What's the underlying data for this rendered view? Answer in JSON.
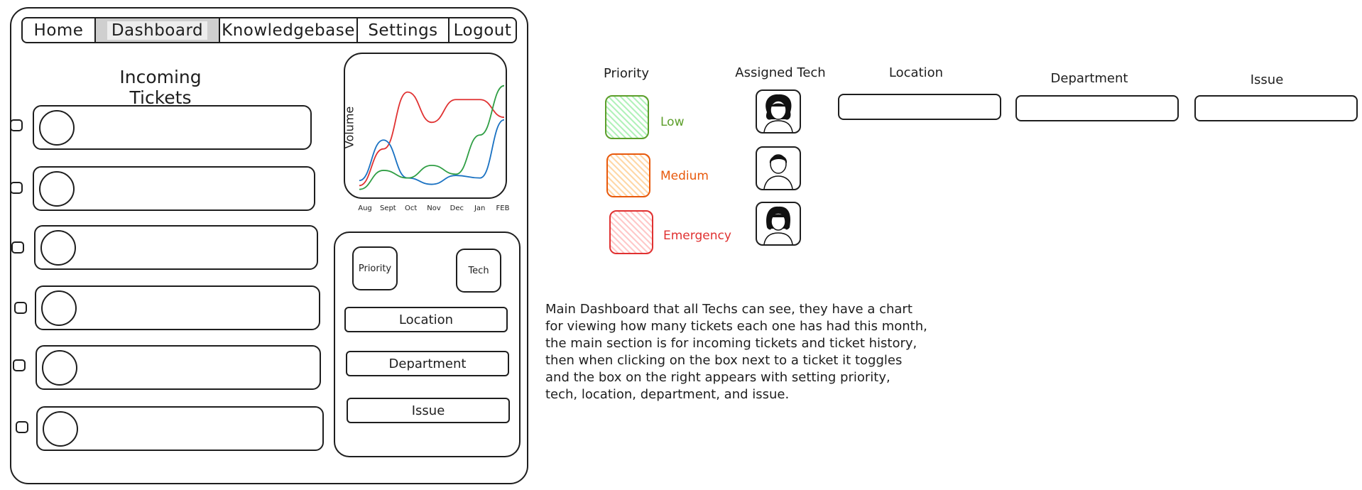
{
  "nav": {
    "tabs": [
      {
        "label": "Home"
      },
      {
        "label": "Dashboard",
        "active": true
      },
      {
        "label": "Knowledgebase"
      },
      {
        "label": "Settings"
      },
      {
        "label": "Logout"
      }
    ]
  },
  "tickets": {
    "title": "Incoming Tickets",
    "count": 6
  },
  "chart_data": {
    "type": "line",
    "ylabel": "Volume",
    "xlabel": "",
    "categories": [
      "Aug",
      "Sept",
      "Oct",
      "Nov",
      "Dec",
      "Jan",
      "FEB"
    ],
    "ylim": [
      0,
      10
    ],
    "series": [
      {
        "color": "#e03131",
        "values": [
          0.6,
          3.5,
          8.0,
          5.6,
          7.4,
          7.4,
          6.0
        ]
      },
      {
        "color": "#1971c2",
        "values": [
          1.0,
          4.2,
          1.2,
          0.7,
          1.4,
          1.2,
          5.8
        ]
      },
      {
        "color": "#2f9e44",
        "values": [
          0.3,
          1.8,
          1.2,
          2.2,
          1.5,
          4.6,
          8.5
        ]
      }
    ]
  },
  "detail_panel": {
    "priority_label": "Priority",
    "tech_label": "Tech",
    "location_label": "Location",
    "department_label": "Department",
    "issue_label": "Issue"
  },
  "legend": {
    "priority_header": "Priority",
    "assigned_tech_header": "Assigned Tech",
    "location_header": "Location",
    "department_header": "Department",
    "issue_header": "Issue",
    "priorities": [
      {
        "label": "Low",
        "color": "#5c9e2a",
        "fill": "#b2f2bb"
      },
      {
        "label": "Medium",
        "color": "#e8590c",
        "fill": "#ffd8a8"
      },
      {
        "label": "Emergency",
        "color": "#e03131",
        "fill": "#ffc9c9"
      }
    ]
  },
  "description": "Main Dashboard that all Techs can see, they have a chart\nfor viewing how many tickets each one has had this month,\nthe main section is for incoming tickets and ticket history,\nthen when clicking on the box next to a ticket it toggles\nand the box on the right appears with setting priority,\ntech, location, department, and issue."
}
